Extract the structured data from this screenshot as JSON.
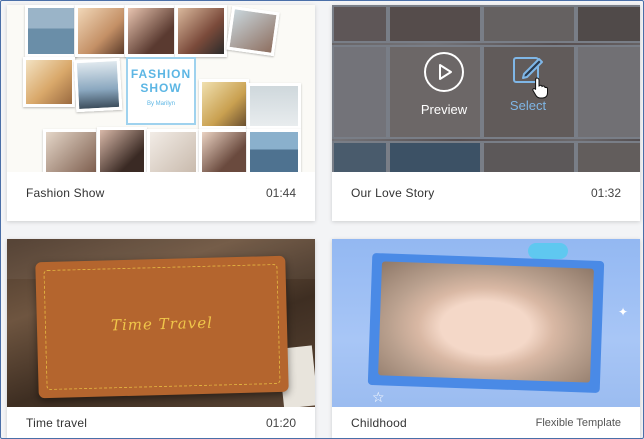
{
  "templates": [
    {
      "title": "Fashion Show",
      "duration": "01:44",
      "card_title_line1": "FASHION",
      "card_title_line2": "SHOW",
      "card_title_line3": "By Marilyn"
    },
    {
      "title": "Our Love Story",
      "duration": "01:32",
      "preview_label": "Preview",
      "select_label": "Select"
    },
    {
      "title": "Time travel",
      "duration": "01:20",
      "card_text": "Time  Travel"
    },
    {
      "title": "Childhood",
      "badge": "Flexible Template"
    }
  ],
  "icons": {
    "preview": "play-icon",
    "select": "edit-icon",
    "cursor": "hand-cursor-icon"
  },
  "colors": {
    "border": "#4a6fa8",
    "fashion_accent": "#5cb6e4",
    "select_accent": "#7fb6e6",
    "book": "#b4652e",
    "childhood_bg": "#8cb4f0"
  }
}
